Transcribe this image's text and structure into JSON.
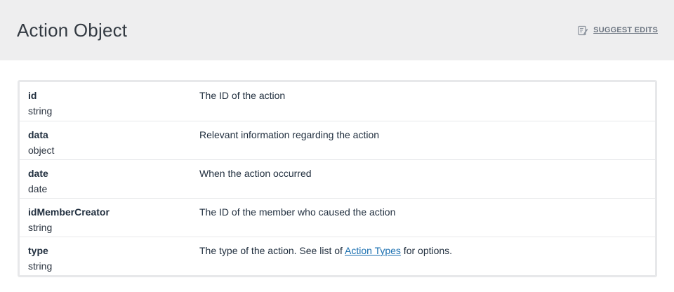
{
  "header": {
    "title": "Action Object",
    "suggest_edits": "SUGGEST EDITS",
    "suggest_icon": "edit-icon"
  },
  "fields": [
    {
      "name": "id",
      "type": "string",
      "description": "The ID of the action"
    },
    {
      "name": "data",
      "type": "object",
      "description": "Relevant information regarding the action"
    },
    {
      "name": "date",
      "type": "date",
      "description": "When the action occurred"
    },
    {
      "name": "idMemberCreator",
      "type": "string",
      "description": "The ID of the member who caused the action"
    },
    {
      "name": "type",
      "type": "string",
      "description_before": "The type of the action. See list of ",
      "description_link": "Action Types",
      "description_after": " for options."
    }
  ],
  "colors": {
    "header_bg": "#eeeeef",
    "link": "#1a6fb0",
    "border": "#e7e8ea"
  }
}
